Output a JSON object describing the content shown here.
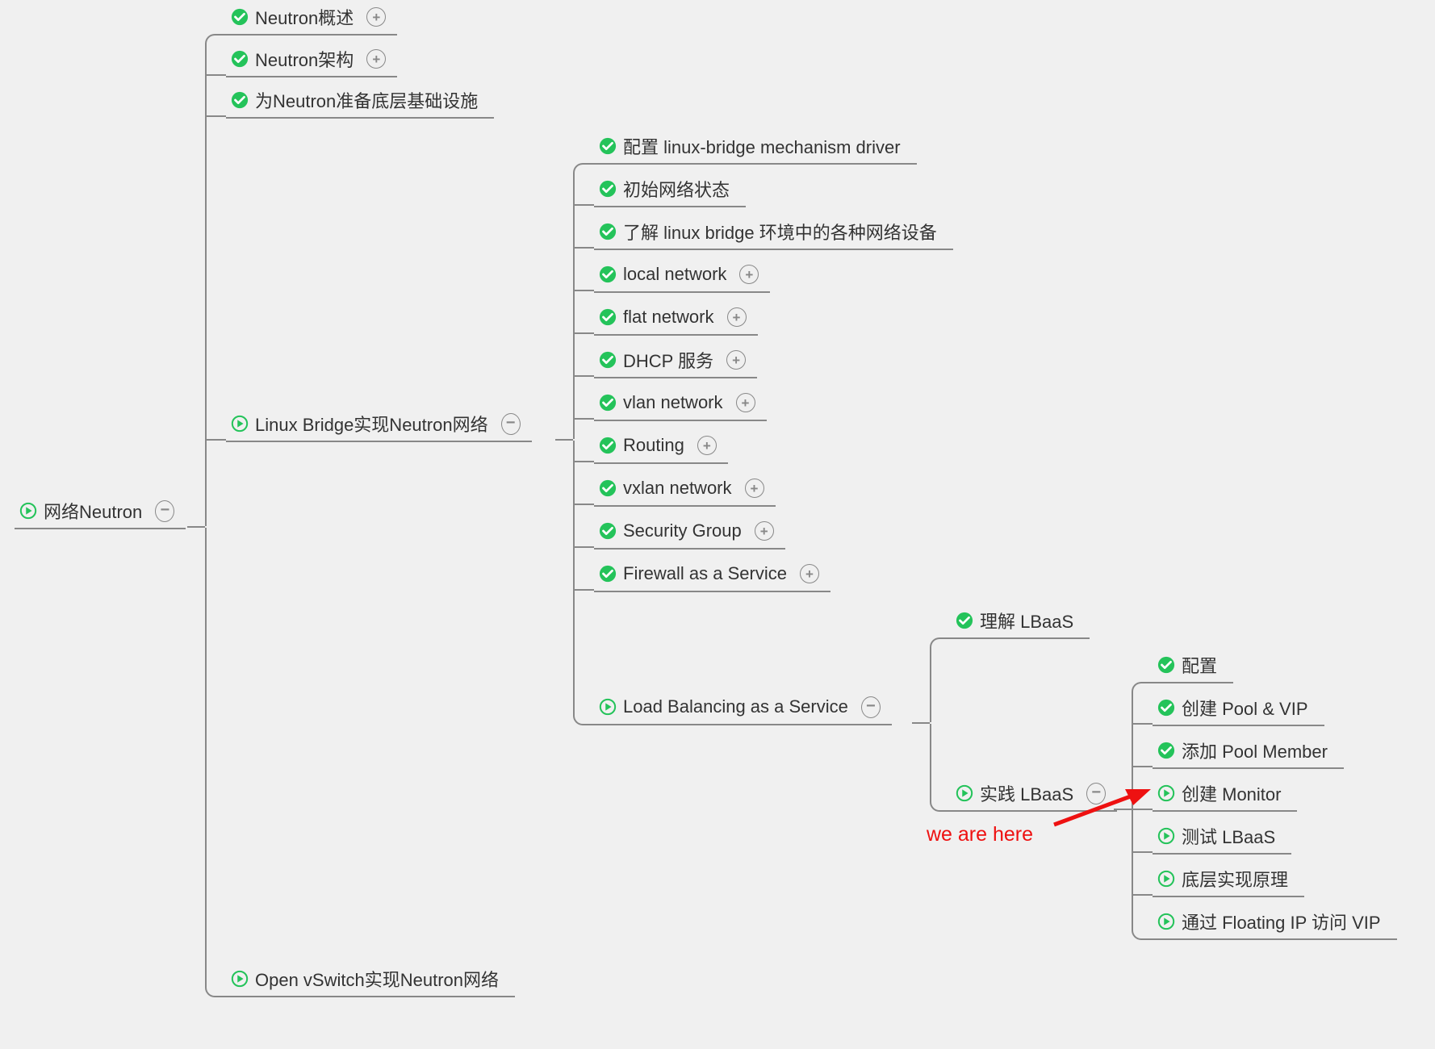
{
  "annotation": {
    "label": "we are here"
  },
  "root": {
    "label": "网络Neutron"
  },
  "level1": [
    {
      "label": "Neutron概述",
      "icon": "check",
      "expand": "plus"
    },
    {
      "label": "Neutron架构",
      "icon": "check",
      "expand": "plus"
    },
    {
      "label": "为Neutron准备底层基础设施",
      "icon": "check",
      "expand": null
    },
    {
      "label": "Linux Bridge实现Neutron网络",
      "icon": "play",
      "expand": "minus"
    },
    {
      "label": "Open vSwitch实现Neutron网络",
      "icon": "play",
      "expand": null
    }
  ],
  "lb_children": [
    {
      "label": "配置 linux-bridge mechanism driver",
      "icon": "check",
      "expand": null
    },
    {
      "label": "初始网络状态",
      "icon": "check",
      "expand": null
    },
    {
      "label": "了解 linux bridge 环境中的各种网络设备",
      "icon": "check",
      "expand": null
    },
    {
      "label": "local network",
      "icon": "check",
      "expand": "plus"
    },
    {
      "label": "flat network",
      "icon": "check",
      "expand": "plus"
    },
    {
      "label": "DHCP 服务",
      "icon": "check",
      "expand": "plus"
    },
    {
      "label": "vlan network",
      "icon": "check",
      "expand": "plus"
    },
    {
      "label": "Routing",
      "icon": "check",
      "expand": "plus"
    },
    {
      "label": "vxlan network",
      "icon": "check",
      "expand": "plus"
    },
    {
      "label": "Security Group",
      "icon": "check",
      "expand": "plus"
    },
    {
      "label": "Firewall as a Service",
      "icon": "check",
      "expand": "plus"
    },
    {
      "label": "Load Balancing as a Service",
      "icon": "play",
      "expand": "minus"
    }
  ],
  "lbaas": [
    {
      "label": "理解 LBaaS",
      "icon": "check",
      "expand": null
    },
    {
      "label": "实践 LBaaS",
      "icon": "play",
      "expand": "minus"
    }
  ],
  "practice": [
    {
      "label": "配置",
      "icon": "check",
      "expand": null
    },
    {
      "label": "创建 Pool & VIP",
      "icon": "check",
      "expand": null
    },
    {
      "label": "添加 Pool Member",
      "icon": "check",
      "expand": null
    },
    {
      "label": "创建 Monitor",
      "icon": "play",
      "expand": null
    },
    {
      "label": "测试 LBaaS",
      "icon": "play",
      "expand": null
    },
    {
      "label": "底层实现原理",
      "icon": "play",
      "expand": null
    },
    {
      "label": "通过 Floating IP 访问 VIP",
      "icon": "play",
      "expand": null
    }
  ]
}
